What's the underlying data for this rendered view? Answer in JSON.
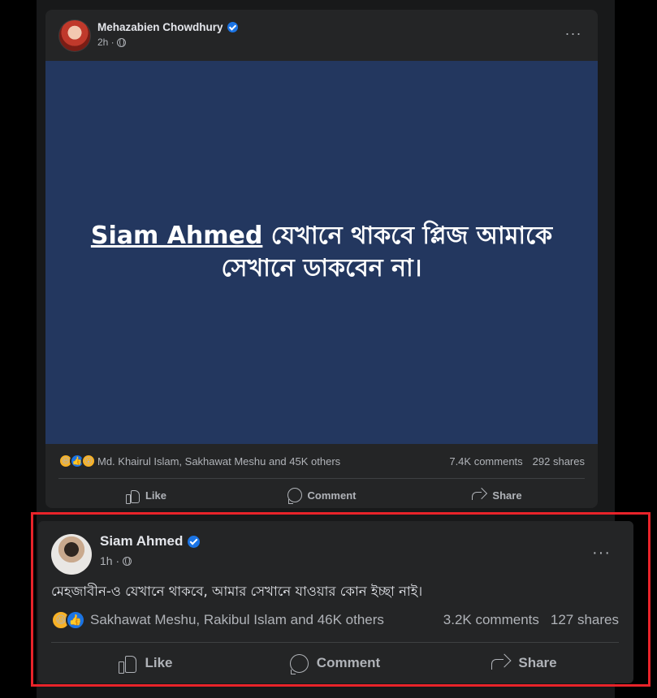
{
  "post1": {
    "author": "Mehazabien Chowdhury",
    "time": "2h ·",
    "banner_tag": "Siam Ahmed",
    "banner_text": " যেখানে থাকবে প্লিজ আমাকে সেখানে ডাকবেন না।",
    "reactions_text": "Md. Khairul Islam, Sakhawat Meshu and 45K others",
    "comments": "7.4K comments",
    "shares": "292 shares",
    "actions": {
      "like": "Like",
      "comment": "Comment",
      "share": "Share"
    }
  },
  "post2": {
    "author": "Siam Ahmed",
    "time": "1h ·",
    "text": "মেহজাবীন-ও যেখানে থাকবে, আমার সেখানে যাওয়ার কোন ইচ্ছা নাই।",
    "reactions_text": "Sakhawat Meshu, Rakibul Islam and 46K others",
    "comments": "3.2K comments",
    "shares": "127 shares",
    "actions": {
      "like": "Like",
      "comment": "Comment",
      "share": "Share"
    }
  },
  "more_icon": "···",
  "colors": {
    "highlight": "#e8232a",
    "banner_bg": "#23375f",
    "verified": "#1b74e4"
  }
}
